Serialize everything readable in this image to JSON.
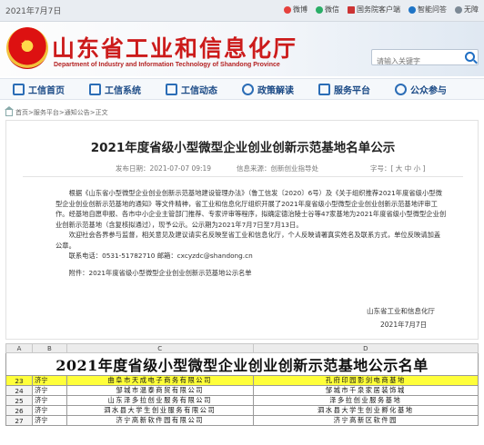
{
  "topbar": {
    "date": "2021年7月7日",
    "links": [
      {
        "icon": "weibo-icon",
        "label": "微博"
      },
      {
        "icon": "wechat-icon",
        "label": "微信"
      },
      {
        "icon": "gov-app-icon",
        "label": "国务院客户端"
      },
      {
        "icon": "robot-icon",
        "label": "智能问答"
      },
      {
        "icon": "help-icon",
        "label": "无障"
      }
    ]
  },
  "header": {
    "title": "山东省工业和信息化厅",
    "subtitle": "Department of Industry and Information Technology of Shandong Province",
    "search_placeholder": "请输入关键字"
  },
  "nav": [
    {
      "icon": "home-icon",
      "label": "工信首页"
    },
    {
      "icon": "building-icon",
      "label": "工信系统"
    },
    {
      "icon": "news-icon",
      "label": "工信动态"
    },
    {
      "icon": "policy-icon",
      "label": "政策解读"
    },
    {
      "icon": "service-icon",
      "label": "服务平台"
    },
    {
      "icon": "public-icon",
      "label": "公众参与"
    }
  ],
  "breadcrumb": "首页>服务平台>通知公告>正文",
  "article": {
    "title": "2021年度省级小型微型企业创业创新示范基地名单公示",
    "publish_time": "发布日期：2021-07-07 09:19",
    "source": "信息来源：创新创业指导处",
    "font_size": "字号：[ 大 中 小 ]",
    "paragraphs": [
      "根据《山东省小型微型企业创业创新示范基地建设管理办法》（鲁工信发〔2020〕6号）及《关于组织推荐2021年度省级小型微型企业创业创新示范基地的通知》等文件精神，省工业和信息化厅组织开展了2021年度省级小型微型企业创业创新示范基地评审工作。经基地自愿申报、各市中小企业主管部门推荐、专家评审等程序，拟确定德治陵士谷等47家基地为2021年度省级小型微型企业创业创新示范基地（含复核拟通过），现予公示。公示期为2021年7月7日至7月13日。",
      "欢迎社会各界参与监督，相关意见及建议请实名反映至省工业和信息化厅，个人反映请署真实姓名及联系方式，单位反映请加盖公章。",
      "联系电话：0531-51782710 邮箱：cxcyzdc@shandong.cn",
      "附件：2021年度省级小型微型企业创业创新示范基地公示名单"
    ],
    "signature": "山东省工业和信息化厅",
    "sign_date": "2021年7月7日"
  },
  "table": {
    "columns": [
      "A",
      "B",
      "C",
      "D"
    ],
    "title": "2021年度省级小型微型企业创业创新示范基地公示名单",
    "rows": [
      {
        "num": "23",
        "city": "济宁",
        "company": "曲阜市天成电子商务有限公司",
        "base": "孔府印园影剑电商基地",
        "highlight": true
      },
      {
        "num": "24",
        "city": "济宁",
        "company": "邹城市温泰商贸有限公司",
        "base": "邹城市千泉家居装饰城",
        "highlight": false
      },
      {
        "num": "25",
        "city": "济宁",
        "company": "山东泽多拉创业服务有限公司",
        "base": "泽多拉创业服务基地",
        "highlight": false
      },
      {
        "num": "26",
        "city": "济宁",
        "company": "泗水县大学生创业服务有限公司",
        "base": "泗水县大学生创业孵化基地",
        "highlight": false
      },
      {
        "num": "27",
        "city": "济宁",
        "company": "济宁高新软件园有限公司",
        "base": "济宁高新区软件园",
        "highlight": false
      }
    ]
  }
}
